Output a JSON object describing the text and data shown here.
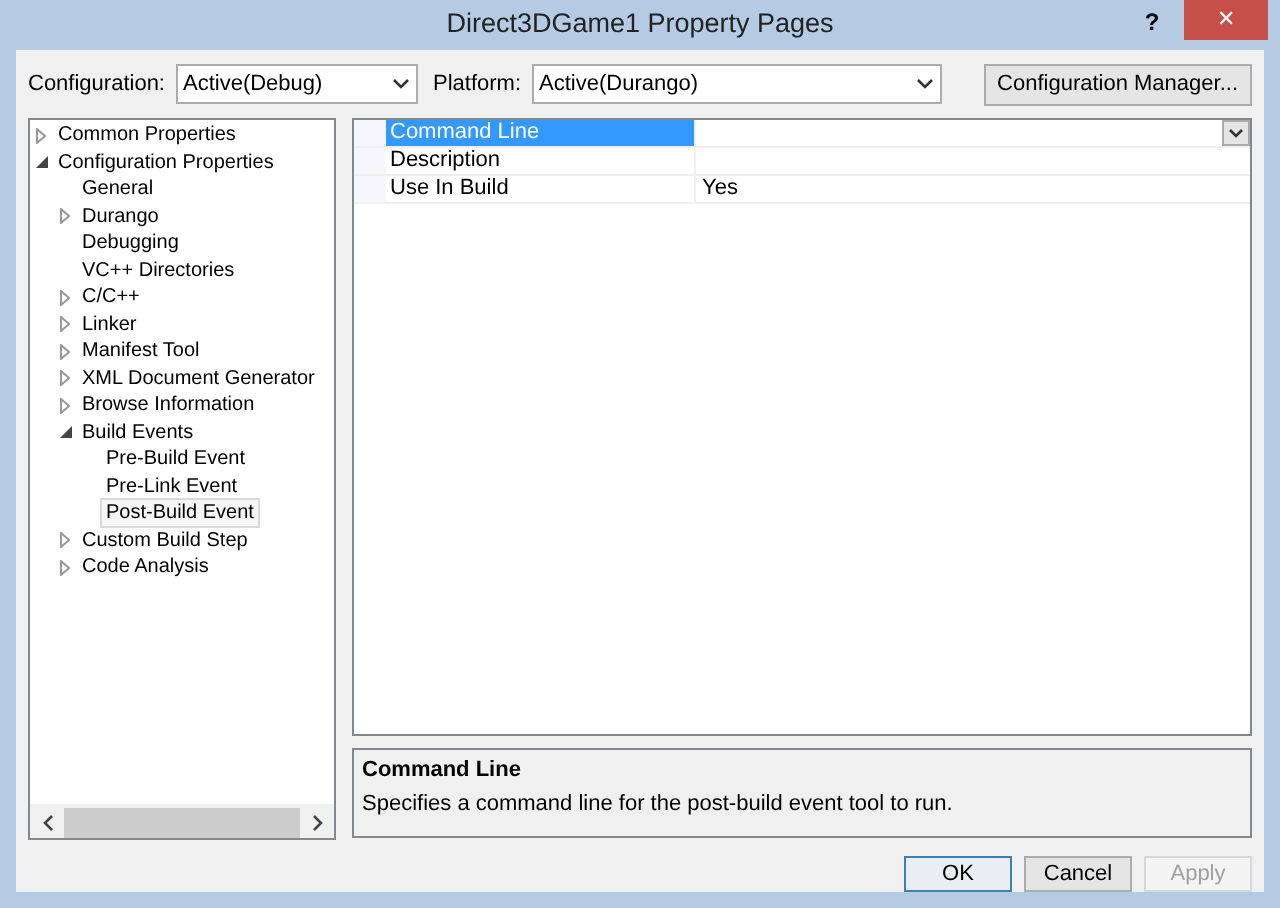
{
  "window": {
    "title": "Direct3DGame1 Property Pages",
    "help": "?",
    "close": "✕"
  },
  "toolbar": {
    "configuration_label": "Configuration:",
    "configuration_value": "Active(Debug)",
    "platform_label": "Platform:",
    "platform_value": "Active(Durango)",
    "manager_button": "Configuration Manager..."
  },
  "tree": [
    {
      "label": "Common Properties",
      "expanded": false,
      "selected": false
    },
    {
      "label": "Configuration Properties",
      "expanded": true,
      "selected": false,
      "children": [
        {
          "label": "General",
          "selected": false
        },
        {
          "label": "Durango",
          "expanded": false,
          "selected": false
        },
        {
          "label": "Debugging",
          "selected": false
        },
        {
          "label": "VC++ Directories",
          "selected": false
        },
        {
          "label": "C/C++",
          "expanded": false,
          "selected": false
        },
        {
          "label": "Linker",
          "expanded": false,
          "selected": false
        },
        {
          "label": "Manifest Tool",
          "expanded": false,
          "selected": false
        },
        {
          "label": "XML Document Generator",
          "expanded": false,
          "selected": false
        },
        {
          "label": "Browse Information",
          "expanded": false,
          "selected": false
        },
        {
          "label": "Build Events",
          "expanded": true,
          "selected": false,
          "children": [
            {
              "label": "Pre-Build Event",
              "selected": false
            },
            {
              "label": "Pre-Link Event",
              "selected": false
            },
            {
              "label": "Post-Build Event",
              "selected": true
            }
          ]
        },
        {
          "label": "Custom Build Step",
          "expanded": false,
          "selected": false
        },
        {
          "label": "Code Analysis",
          "expanded": false,
          "selected": false
        }
      ]
    }
  ],
  "properties": [
    {
      "name": "Command Line",
      "selected": true
    },
    {
      "name": "Description",
      "selected": false
    },
    {
      "name": "Use In Build",
      "value": "Yes",
      "selected": false
    }
  ],
  "description": {
    "title": "Command Line",
    "text": "Specifies a command line for the post-build event tool to run."
  },
  "buttons": [
    {
      "label": "OK",
      "default": true,
      "disabled": false
    },
    {
      "label": "Cancel",
      "default": false,
      "disabled": false
    },
    {
      "label": "Apply",
      "default": false,
      "disabled": true
    }
  ]
}
